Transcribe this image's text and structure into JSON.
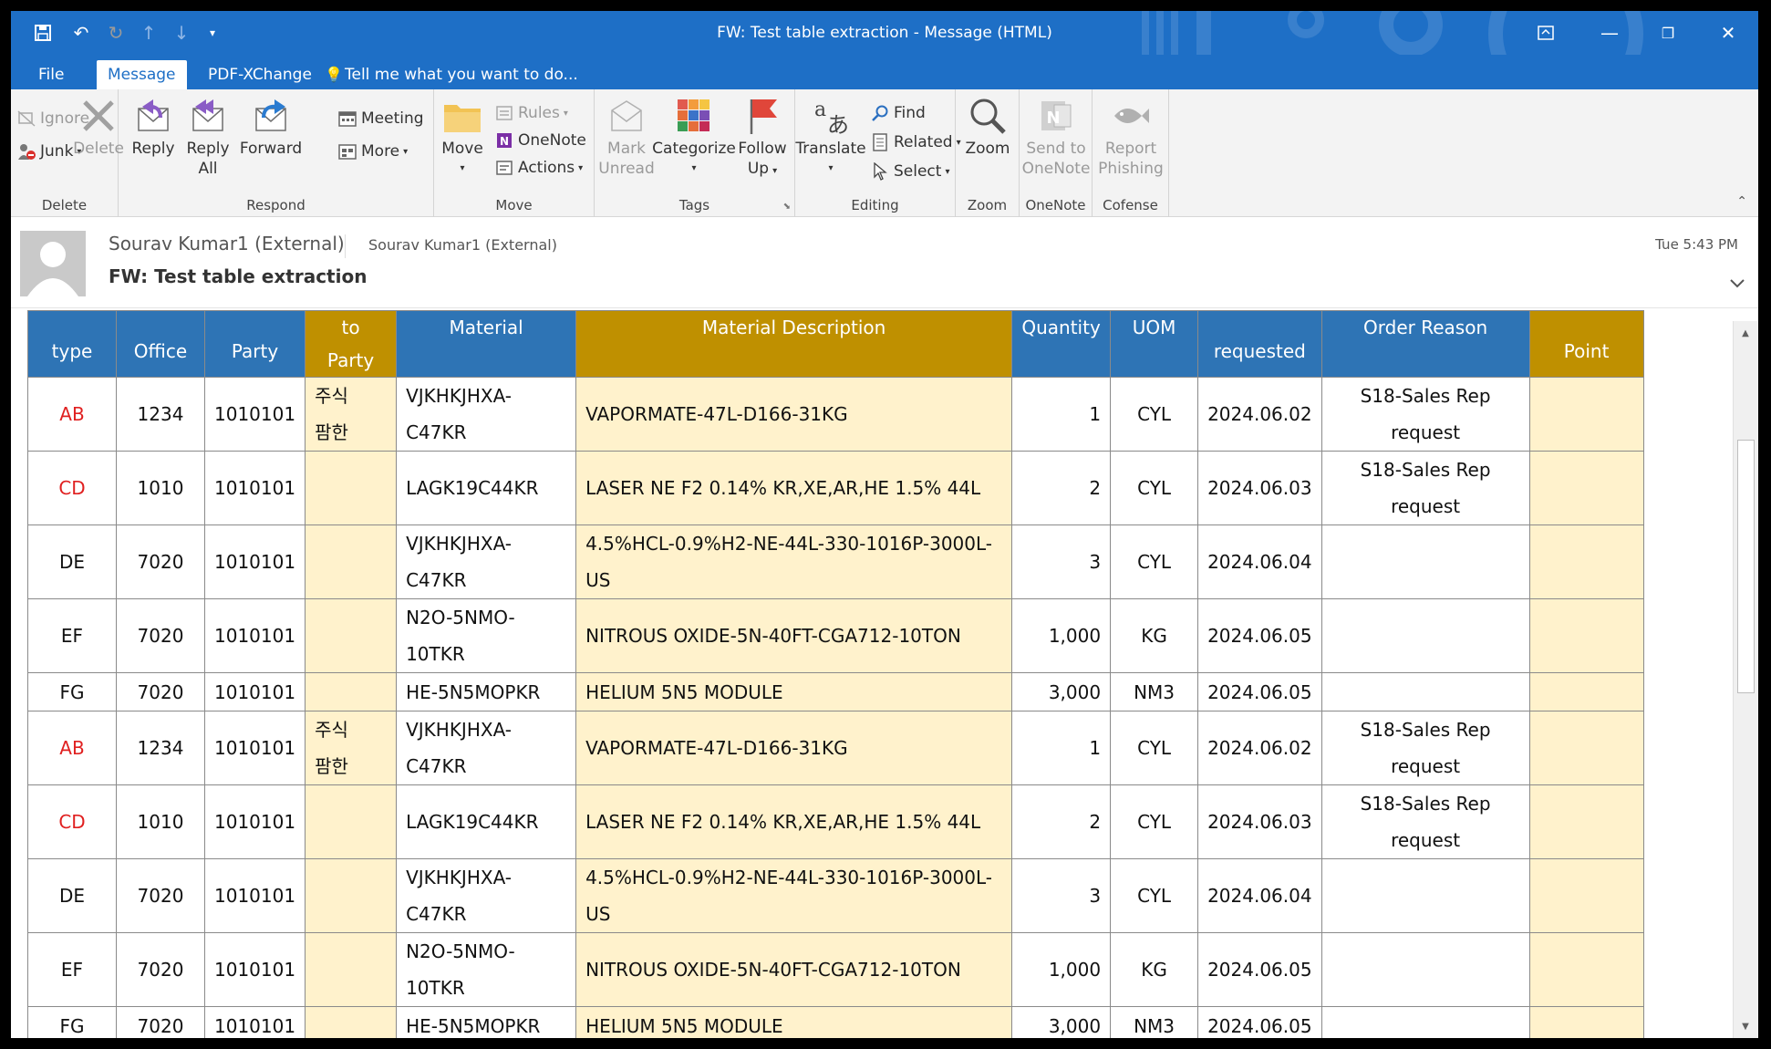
{
  "window": {
    "title": "FW: Test table extraction - Message (HTML)"
  },
  "menu_tabs": [
    "File",
    "Message",
    "PDF-XChange",
    "Tell me what you want to do..."
  ],
  "ribbon": {
    "delete": {
      "ignore": "Ignore",
      "delete": "Delete",
      "junk": "Junk",
      "label": "Delete"
    },
    "respond": {
      "reply": "Reply",
      "reply_all_1": "Reply",
      "reply_all_2": "All",
      "forward": "Forward",
      "meeting": "Meeting",
      "more": "More",
      "label": "Respond"
    },
    "move": {
      "move": "Move",
      "rules": "Rules",
      "onenote": "OneNote",
      "actions": "Actions",
      "label": "Move"
    },
    "tags": {
      "mark_1": "Mark",
      "mark_2": "Unread",
      "categorize": "Categorize",
      "follow_1": "Follow",
      "follow_2": "Up",
      "label": "Tags"
    },
    "editing": {
      "translate": "Translate",
      "find": "Find",
      "related": "Related",
      "select": "Select",
      "label": "Editing"
    },
    "zoom": {
      "zoom": "Zoom",
      "label": "Zoom"
    },
    "onenote": {
      "send_1": "Send to",
      "send_2": "OneNote",
      "label": "OneNote"
    },
    "cofense": {
      "report_1": "Report",
      "report_2": "Phishing",
      "label": "Cofense"
    }
  },
  "message": {
    "sender": "Sourav Kumar1 (External)",
    "sender_secondary": "Sourav Kumar1 (External)",
    "time": "Tue 5:43 PM",
    "subject": "FW: Test table extraction"
  },
  "table": {
    "headers": {
      "type": "type",
      "office": "Office",
      "party": "Party",
      "to_party_1": "to",
      "to_party_2": "Party",
      "material": "Material",
      "material_description": "Material Description",
      "quantity": "Quantity",
      "uom": "UOM",
      "requested": "requested",
      "order_reason": "Order Reason",
      "point": "Point"
    },
    "rows": [
      {
        "type": "AB",
        "office": "1234",
        "party": "1010101",
        "to_party_1": "주식",
        "to_party_2": "팜한",
        "material_1": "VJKHKJHXA-",
        "material_2": "C47KR",
        "desc_1": "VAPORMATE-47L-D166-31KG",
        "desc_2": "",
        "qty": "1",
        "uom": "CYL",
        "date": "2024.06.02",
        "reason_1": "S18-Sales Rep",
        "reason_2": "request",
        "point": ""
      },
      {
        "type": "CD",
        "office": "1010",
        "party": "1010101",
        "to_party_1": "",
        "to_party_2": "",
        "material_1": "LAGK19C44KR",
        "material_2": "",
        "desc_1": "LASER NE F2 0.14% KR,XE,AR,HE 1.5% 44L",
        "desc_2": "",
        "qty": "2",
        "uom": "CYL",
        "date": "2024.06.03",
        "reason_1": "S18-Sales Rep",
        "reason_2": "request",
        "point": ""
      },
      {
        "type": "DE",
        "office": "7020",
        "party": "1010101",
        "to_party_1": "",
        "to_party_2": "",
        "material_1": "VJKHKJHXA-",
        "material_2": "C47KR",
        "desc_1": "4.5%HCL-0.9%H2-NE-44L-330-1016P-3000L-",
        "desc_2": "US",
        "qty": "3",
        "uom": "CYL",
        "date": "2024.06.04",
        "reason_1": "",
        "reason_2": "",
        "point": ""
      },
      {
        "type": "EF",
        "office": "7020",
        "party": "1010101",
        "to_party_1": "",
        "to_party_2": "",
        "material_1": "N2O-5NMO-",
        "material_2": "10TKR",
        "desc_1": "NITROUS OXIDE-5N-40FT-CGA712-10TON",
        "desc_2": "",
        "qty": "1,000",
        "uom": "KG",
        "date": "2024.06.05",
        "reason_1": "",
        "reason_2": "",
        "point": ""
      },
      {
        "type": "FG",
        "office": "7020",
        "party": "1010101",
        "to_party_1": "",
        "to_party_2": "",
        "material_1": "HE-5N5MOPKR",
        "material_2": "",
        "desc_1": "HELIUM 5N5 MODULE",
        "desc_2": "",
        "qty": "3,000",
        "uom": "NM3",
        "date": "2024.06.05",
        "reason_1": "",
        "reason_2": "",
        "point": ""
      },
      {
        "type": "AB",
        "office": "1234",
        "party": "1010101",
        "to_party_1": "주식",
        "to_party_2": "팜한",
        "material_1": "VJKHKJHXA-",
        "material_2": "C47KR",
        "desc_1": "VAPORMATE-47L-D166-31KG",
        "desc_2": "",
        "qty": "1",
        "uom": "CYL",
        "date": "2024.06.02",
        "reason_1": "S18-Sales Rep",
        "reason_2": "request",
        "point": ""
      },
      {
        "type": "CD",
        "office": "1010",
        "party": "1010101",
        "to_party_1": "",
        "to_party_2": "",
        "material_1": "LAGK19C44KR",
        "material_2": "",
        "desc_1": "LASER NE F2 0.14% KR,XE,AR,HE 1.5% 44L",
        "desc_2": "",
        "qty": "2",
        "uom": "CYL",
        "date": "2024.06.03",
        "reason_1": "S18-Sales Rep",
        "reason_2": "request",
        "point": ""
      },
      {
        "type": "DE",
        "office": "7020",
        "party": "1010101",
        "to_party_1": "",
        "to_party_2": "",
        "material_1": "VJKHKJHXA-",
        "material_2": "C47KR",
        "desc_1": "4.5%HCL-0.9%H2-NE-44L-330-1016P-3000L-",
        "desc_2": "US",
        "qty": "3",
        "uom": "CYL",
        "date": "2024.06.04",
        "reason_1": "",
        "reason_2": "",
        "point": ""
      },
      {
        "type": "EF",
        "office": "7020",
        "party": "1010101",
        "to_party_1": "",
        "to_party_2": "",
        "material_1": "N2O-5NMO-",
        "material_2": "10TKR",
        "desc_1": "NITROUS OXIDE-5N-40FT-CGA712-10TON",
        "desc_2": "",
        "qty": "1,000",
        "uom": "KG",
        "date": "2024.06.05",
        "reason_1": "",
        "reason_2": "",
        "point": ""
      },
      {
        "type": "FG",
        "office": "7020",
        "party": "1010101",
        "to_party_1": "",
        "to_party_2": "",
        "material_1": "HE-5N5MOPKR",
        "material_2": "",
        "desc_1": "HELIUM 5N5 MODULE",
        "desc_2": "",
        "qty": "3,000",
        "uom": "NM3",
        "date": "2024.06.05",
        "reason_1": "",
        "reason_2": "",
        "point": ""
      }
    ],
    "red_types": [
      "AB",
      "CD"
    ]
  },
  "colors": {
    "titlebar": "#1e6fc6",
    "header_blue": "#2e74b5",
    "header_gold": "#bf9000",
    "cell_yellow": "#fff2cc",
    "type_red": "#e02020"
  }
}
